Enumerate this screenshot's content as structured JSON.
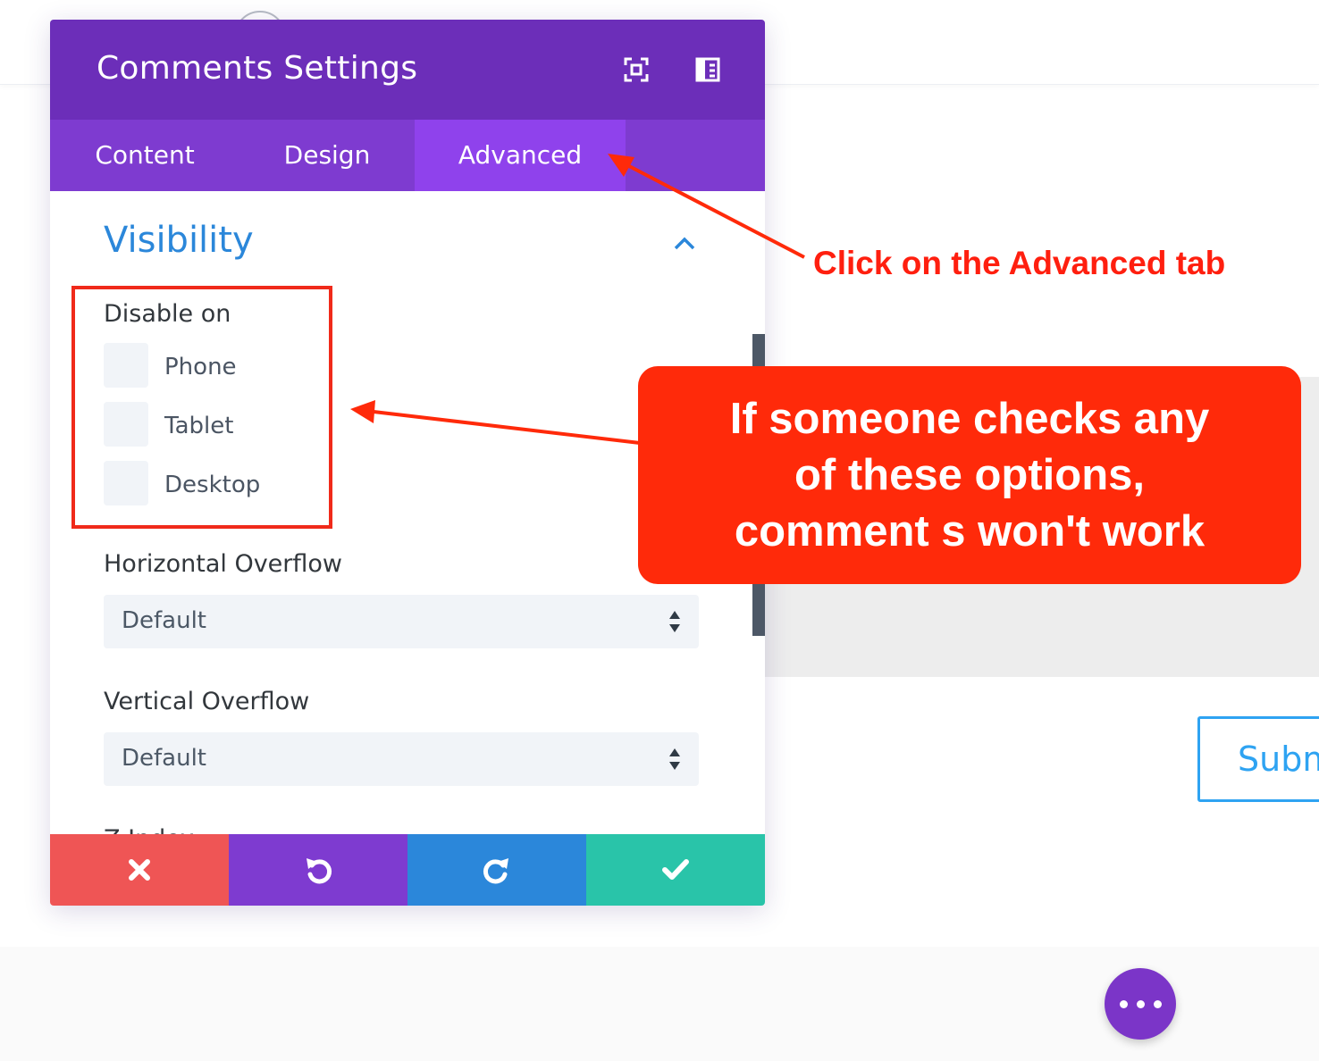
{
  "modal": {
    "title": "Comments Settings",
    "tabs": [
      {
        "label": "Content",
        "active": false
      },
      {
        "label": "Design",
        "active": false
      },
      {
        "label": "Advanced",
        "active": true
      }
    ],
    "section": {
      "title": "Visibility",
      "disable_label": "Disable on",
      "options": [
        "Phone",
        "Tablet",
        "Desktop"
      ],
      "horizontal_overflow_label": "Horizontal Overflow",
      "horizontal_overflow_value": "Default",
      "vertical_overflow_label": "Vertical Overflow",
      "vertical_overflow_value": "Default",
      "next_label_partial": "Z Index"
    }
  },
  "background": {
    "submit_label": "Submit"
  },
  "annotations": {
    "tab_note": "Click on the Advanced tab",
    "callout_lines": [
      "If someone checks any",
      "of these options,",
      "comment s won't work"
    ]
  },
  "colors": {
    "header": "#6c2eb9",
    "tabs": "#7e3bd0",
    "active_tab": "#8f42ec",
    "cancel": "#ef5555",
    "undo": "#7e3bd0",
    "redo": "#2b87da",
    "save": "#29c4a9",
    "annotation_red": "#ff2a0a",
    "link_blue": "#2b87da"
  },
  "icons": {
    "header": [
      "focus-expand-icon",
      "sidebar-layout-icon"
    ],
    "footer": [
      "close-icon",
      "undo-icon",
      "redo-icon",
      "checkmark-icon"
    ],
    "fab": "more-dots-icon",
    "section": "chevron-up-icon",
    "select": "select-arrows-icon"
  }
}
